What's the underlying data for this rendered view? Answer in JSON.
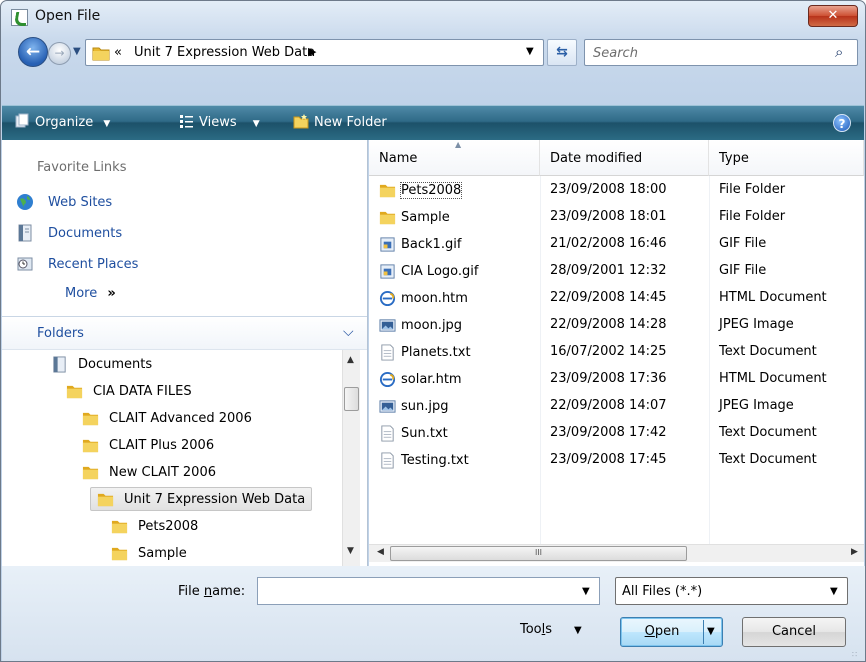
{
  "window": {
    "title": "Open File",
    "close_label": "✕"
  },
  "address": {
    "chevrons": "«",
    "path": "Unit 7 Expression Web Data",
    "separator_arrow": "▶"
  },
  "search": {
    "placeholder": "Search"
  },
  "toolbar": {
    "organize_label": "Organize",
    "views_label": "Views",
    "new_folder_label": "New Folder",
    "help_label": "?"
  },
  "favorites": {
    "title": "Favorite Links",
    "items": [
      {
        "label": "Web Sites",
        "icon": "globe-icon"
      },
      {
        "label": "Documents",
        "icon": "documents-icon"
      },
      {
        "label": "Recent Places",
        "icon": "recent-places-icon"
      }
    ],
    "more_label": "More",
    "more_arrow": "»"
  },
  "folders": {
    "title": "Folders",
    "tree": [
      {
        "label": "Documents",
        "icon": "documents-icon",
        "level": 0
      },
      {
        "label": "CIA DATA FILES",
        "icon": "folder-icon",
        "level": 1
      },
      {
        "label": "CLAIT Advanced 2006",
        "icon": "folder-icon",
        "level": 2
      },
      {
        "label": "CLAIT Plus 2006",
        "icon": "folder-icon",
        "level": 2
      },
      {
        "label": "New CLAIT 2006",
        "icon": "folder-icon",
        "level": 2
      },
      {
        "label": "Unit 7 Expression Web Data",
        "icon": "folder-icon",
        "level": 3,
        "selected": true
      },
      {
        "label": "Pets2008",
        "icon": "folder-icon",
        "level": 4
      },
      {
        "label": "Sample",
        "icon": "folder-icon",
        "level": 4
      }
    ]
  },
  "file_list": {
    "columns": [
      "Name",
      "Date modified",
      "Type"
    ],
    "rows": [
      {
        "name": "Pets2008",
        "date": "23/09/2008 18:00",
        "type": "File Folder",
        "icon": "folder-icon"
      },
      {
        "name": "Sample",
        "date": "23/09/2008 18:01",
        "type": "File Folder",
        "icon": "folder-icon"
      },
      {
        "name": "Back1.gif",
        "date": "21/02/2008 16:46",
        "type": "GIF File",
        "icon": "gif-file-icon"
      },
      {
        "name": "CIA Logo.gif",
        "date": "28/09/2001 12:32",
        "type": "GIF File",
        "icon": "gif-file-icon"
      },
      {
        "name": "moon.htm",
        "date": "22/09/2008 14:45",
        "type": "HTML Document",
        "icon": "html-file-icon"
      },
      {
        "name": "moon.jpg",
        "date": "22/09/2008 14:28",
        "type": "JPEG Image",
        "icon": "jpeg-file-icon"
      },
      {
        "name": "Planets.txt",
        "date": "16/07/2002 14:25",
        "type": "Text Document",
        "icon": "text-file-icon"
      },
      {
        "name": "solar.htm",
        "date": "23/09/2008 17:36",
        "type": "HTML Document",
        "icon": "html-file-icon"
      },
      {
        "name": "sun.jpg",
        "date": "22/09/2008 14:07",
        "type": "JPEG Image",
        "icon": "jpeg-file-icon"
      },
      {
        "name": "Sun.txt",
        "date": "23/09/2008 17:42",
        "type": "Text Document",
        "icon": "text-file-icon"
      },
      {
        "name": "Testing.txt",
        "date": "23/09/2008 17:45",
        "type": "Text Document",
        "icon": "text-file-icon"
      }
    ],
    "hscroll_thumb_label": "III"
  },
  "bottom": {
    "file_name_label_pre": "File ",
    "file_name_label_u": "n",
    "file_name_label_post": "ame:",
    "file_name_value": "",
    "filter_value": "All Files (*.*)",
    "tools_pre": "Too",
    "tools_u": "l",
    "tools_post": "s",
    "open_u": "O",
    "open_post": "pen",
    "cancel_label": "Cancel"
  },
  "colors": {
    "accent": "#1e4e9f",
    "toolbar": "#2f6a87",
    "folder": "#e8b830"
  }
}
